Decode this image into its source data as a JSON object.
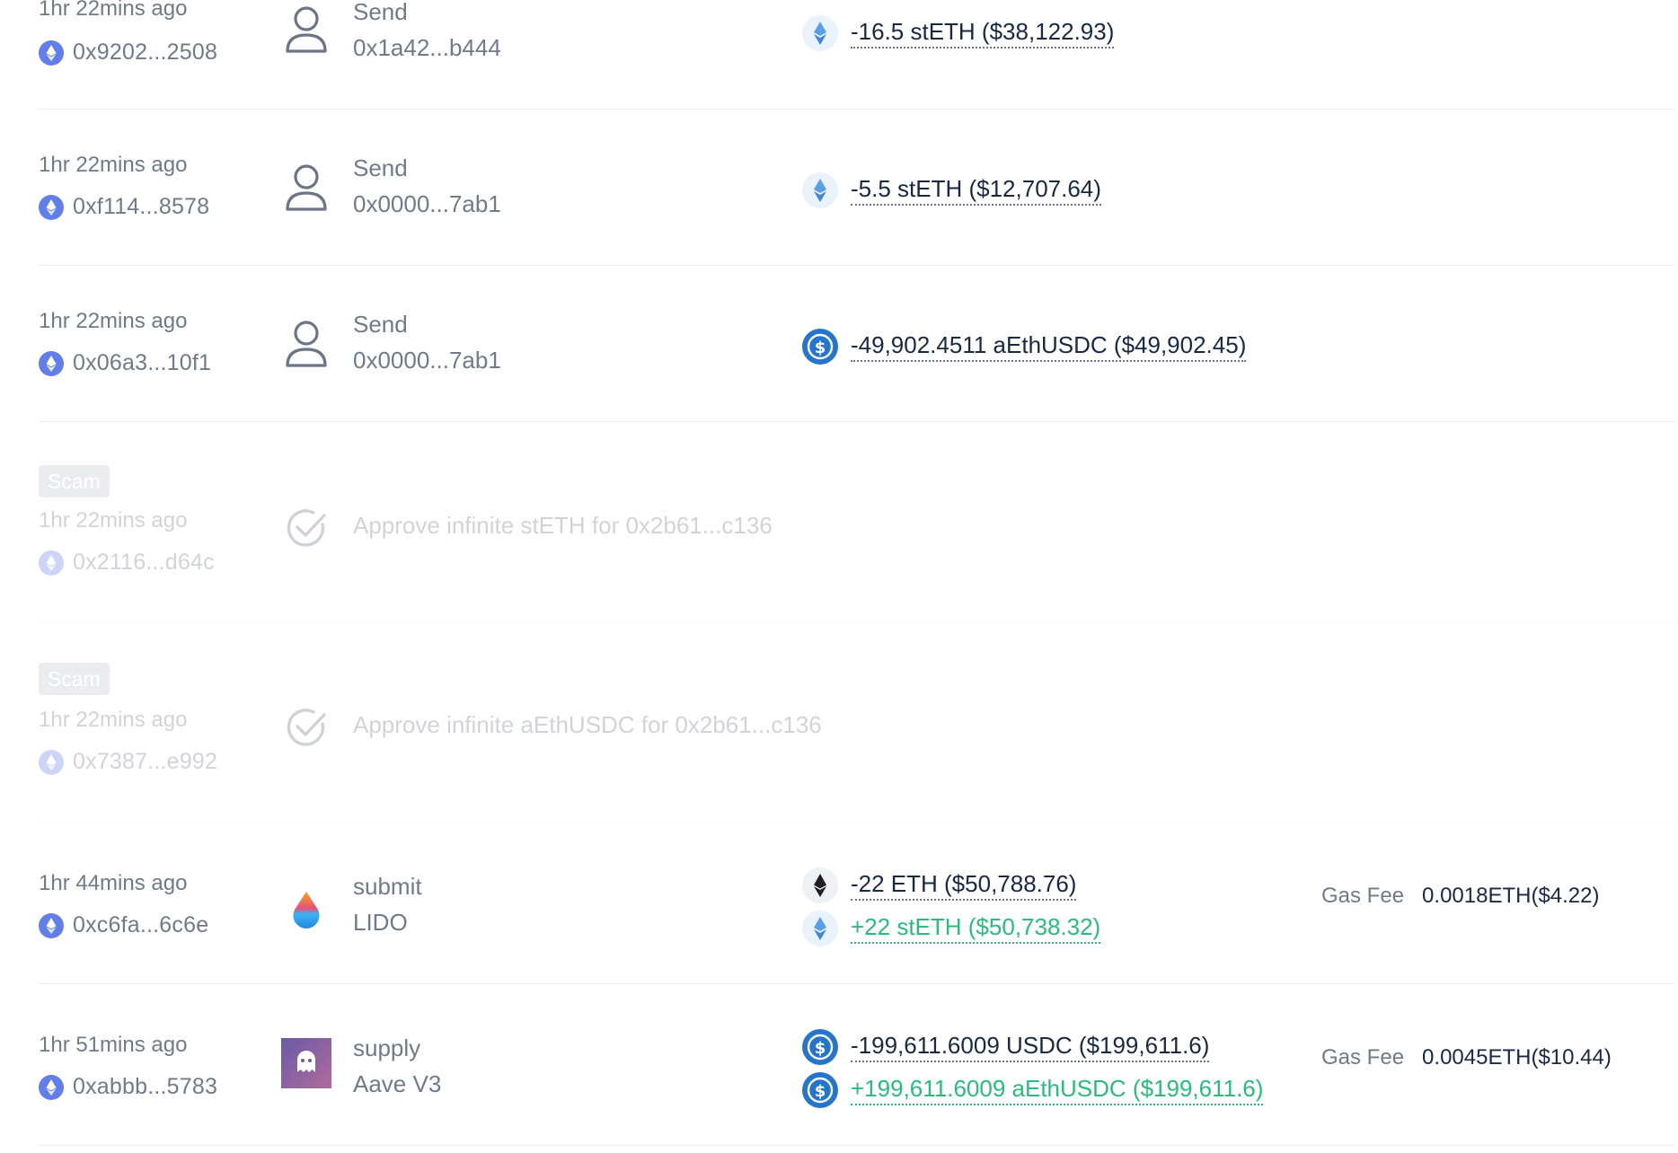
{
  "rows": [
    {
      "time": "1hr 22mins ago",
      "hash": "0x9202...2508",
      "action": "Send",
      "target": "0x1a42...b444",
      "tokens": [
        {
          "amount": "-16.5 stETH ($38,122.93)",
          "icon": "steth-icon"
        }
      ]
    },
    {
      "time": "1hr 22mins ago",
      "hash": "0xf114...8578",
      "action": "Send",
      "target": "0x0000...7ab1",
      "tokens": [
        {
          "amount": "-5.5 stETH ($12,707.64)",
          "icon": "steth-icon"
        }
      ]
    },
    {
      "time": "1hr 22mins ago",
      "hash": "0x06a3...10f1",
      "action": "Send",
      "target": "0x0000...7ab1",
      "tokens": [
        {
          "amount": "-49,902.4511 aEthUSDC ($49,902.45)",
          "icon": "usdc-icon"
        }
      ]
    },
    {
      "badge": "Scam tx",
      "time": "1hr 22mins ago",
      "hash": "0x2116...d64c",
      "action_text": "Approve infinite stETH for 0x2b61...c136"
    },
    {
      "badge": "Scam tx",
      "time": "1hr 22mins ago",
      "hash": "0x7387...e992",
      "action_text": "Approve infinite aEthUSDC for 0x2b61...c136"
    },
    {
      "time": "1hr 44mins ago",
      "hash": "0xc6fa...6c6e",
      "action": "submit",
      "target": "LIDO",
      "tokens": [
        {
          "amount": "-22 ETH ($50,788.76)",
          "icon": "eth-icon"
        },
        {
          "amount": "+22 stETH ($50,738.32)",
          "icon": "steth-icon"
        }
      ],
      "gas_label": "Gas Fee",
      "gas_value": "0.0018ETH($4.22)"
    },
    {
      "time": "1hr 51mins ago",
      "hash": "0xabbb...5783",
      "action": "supply",
      "target": "Aave V3",
      "tokens": [
        {
          "amount": "-199,611.6009 USDC ($199,611.6)",
          "icon": "usdc-icon"
        },
        {
          "amount": "+199,611.6009 aEthUSDC ($199,611.6)",
          "icon": "usdc-icon"
        }
      ],
      "gas_label": "Gas Fee",
      "gas_value": "0.0045ETH($10.44)"
    }
  ],
  "colors": {
    "muted_text": "#707a8a",
    "dark_text": "#192945",
    "positive": "#2abb7f",
    "chain_blue": "#627eea",
    "usdc_blue": "#2775ca"
  }
}
